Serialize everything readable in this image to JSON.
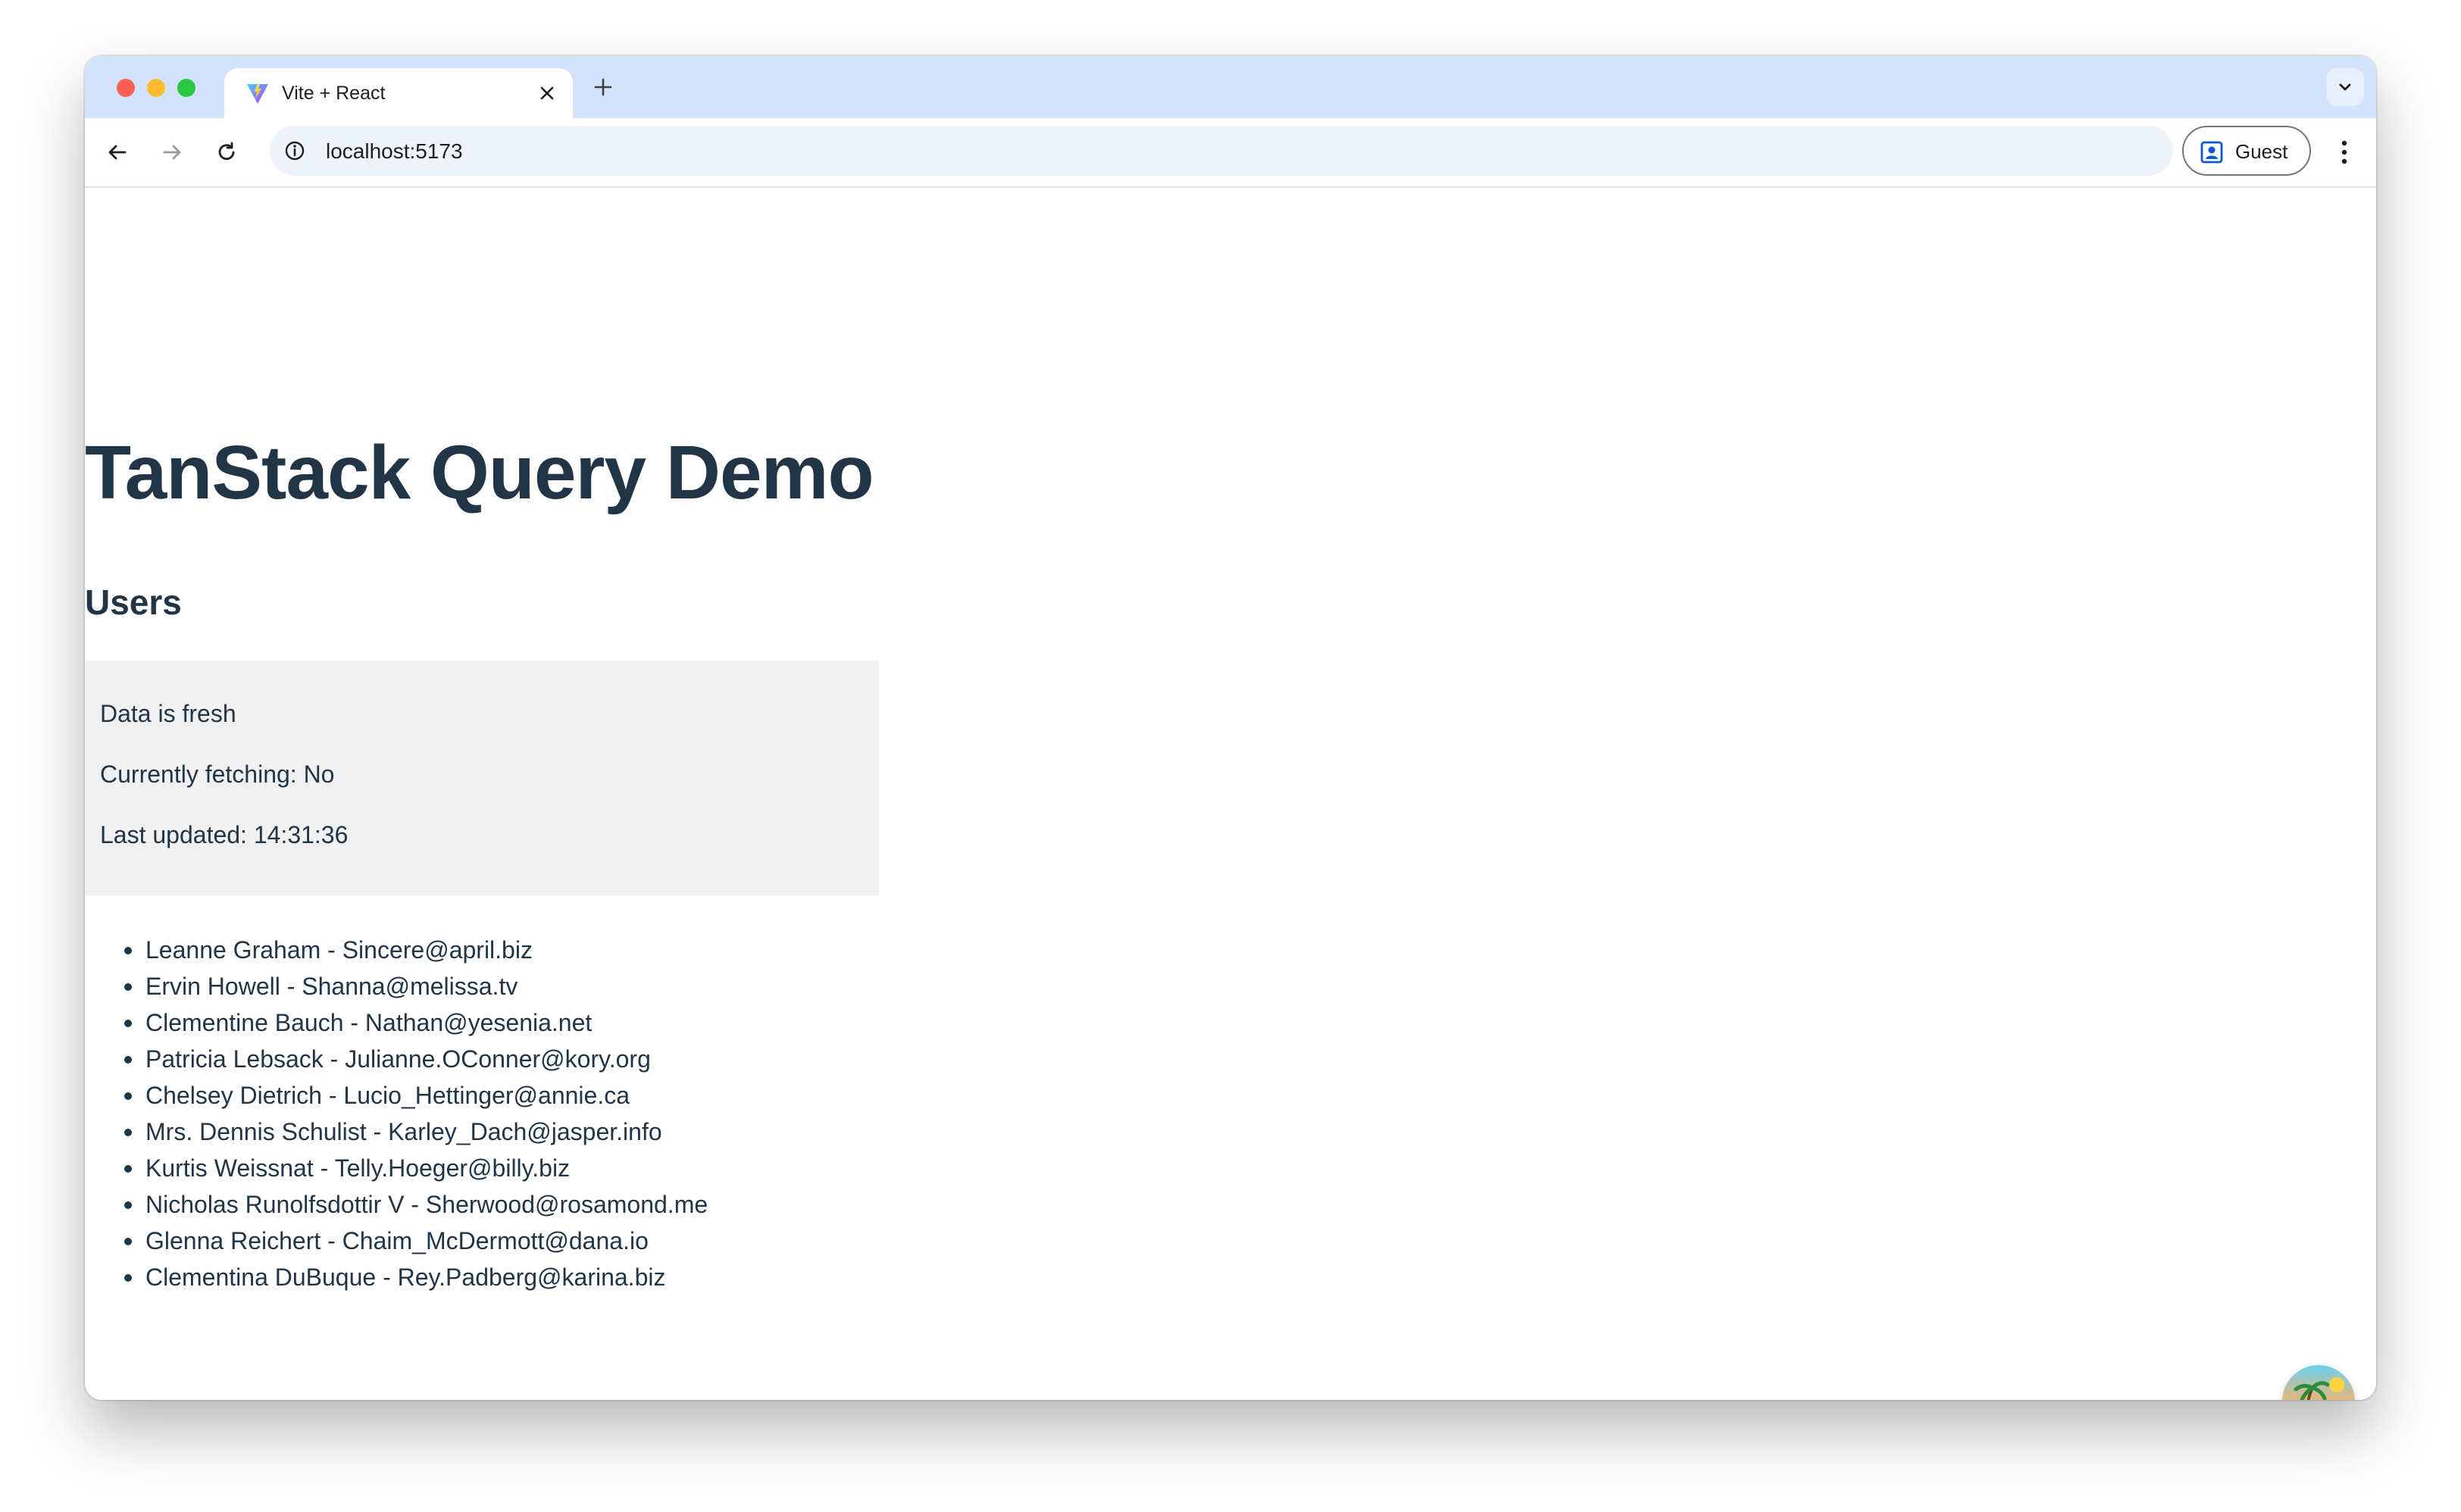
{
  "browser": {
    "tab": {
      "title": "Vite + React",
      "favicon": "vite-logo-icon",
      "close_icon": "close-icon"
    },
    "new_tab_icon": "plus-icon",
    "tab_menu_icon": "chevron-down-icon",
    "address_bar": {
      "url": "localhost:5173",
      "site_info_icon": "info-icon"
    },
    "profile": {
      "label": "Guest",
      "icon": "person-badge-icon"
    },
    "menu_icon": "kebab-menu-icon"
  },
  "page": {
    "title": "TanStack Query Demo",
    "section_title": "Users",
    "status": {
      "freshness": "Data is fresh",
      "fetching": "Currently fetching: No",
      "last_updated": "Last updated: 14:31:36"
    },
    "users": [
      "Leanne Graham - Sincere@april.biz",
      "Ervin Howell - Shanna@melissa.tv",
      "Clementine Bauch - Nathan@yesenia.net",
      "Patricia Lebsack - Julianne.OConner@kory.org",
      "Chelsey Dietrich - Lucio_Hettinger@annie.ca",
      "Mrs. Dennis Schulist - Karley_Dach@jasper.info",
      "Kurtis Weissnat - Telly.Hoeger@billy.biz",
      "Nicholas Runolfsdottir V - Sherwood@rosamond.me",
      "Glenna Reichert - Chaim_McDermott@dana.io",
      "Clementina DuBuque - Rey.Padberg@karina.biz"
    ],
    "devtools_icon": "tanstack-devtools-icon"
  },
  "colors": {
    "titlebar": "#d3e3fd",
    "text": "#213547",
    "status_box": "#f0f0f0"
  }
}
